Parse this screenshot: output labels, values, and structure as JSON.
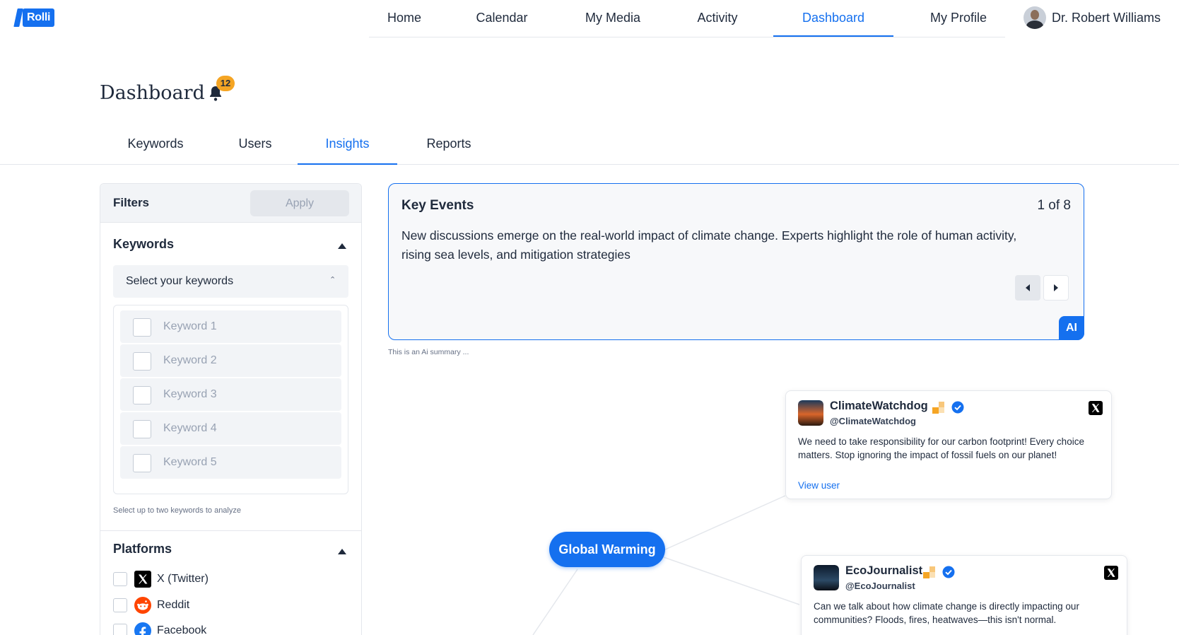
{
  "brand": {
    "name": "Rolli"
  },
  "nav": {
    "items": [
      {
        "label": "Home"
      },
      {
        "label": "Calendar"
      },
      {
        "label": "My Media"
      },
      {
        "label": "Activity"
      },
      {
        "label": "Dashboard"
      },
      {
        "label": "My Profile"
      }
    ],
    "active": "Dashboard",
    "user": "Dr. Robert Williams"
  },
  "page": {
    "title": "Dashboard",
    "notifications": "12"
  },
  "tabs": [
    {
      "label": "Keywords"
    },
    {
      "label": "Users"
    },
    {
      "label": "Insights"
    },
    {
      "label": "Reports"
    }
  ],
  "filters": {
    "title": "Filters",
    "apply": "Apply",
    "keywords": {
      "title": "Keywords",
      "placeholder": "Select your keywords",
      "items": [
        "Keyword 1",
        "Keyword 2",
        "Keyword 3",
        "Keyword 4",
        "Keyword 5"
      ],
      "hint": "Select up to two keywords to analyze"
    },
    "platforms": {
      "title": "Platforms",
      "items": [
        "X (Twitter)",
        "Reddit",
        "Facebook"
      ]
    }
  },
  "key_events": {
    "title": "Key Events",
    "counter": "1 of 8",
    "text": "New discussions emerge on the real-world impact of climate change. Experts highlight the role of human activity, rising sea levels, and mitigation strategies",
    "ai_label": "AI",
    "note": "This is an Ai summary ..."
  },
  "graph": {
    "center": "Global Warming",
    "posts": [
      {
        "name": "ClimateWatchdog",
        "handle": "@ClimateWatchdog",
        "text": "We need to take responsibility for our carbon footprint! Every choice matters. Stop ignoring the impact of fossil fuels on our planet!",
        "link": "View user"
      },
      {
        "name": "EcoJournalist",
        "handle": "@EcoJournalist",
        "text": "Can we talk about how climate change is directly impacting our communities? Floods, fires, heatwaves—this isn't normal."
      }
    ]
  },
  "colors": {
    "accent": "#1570ef",
    "badge": "#f5a524",
    "muted": "#98a2b3"
  }
}
